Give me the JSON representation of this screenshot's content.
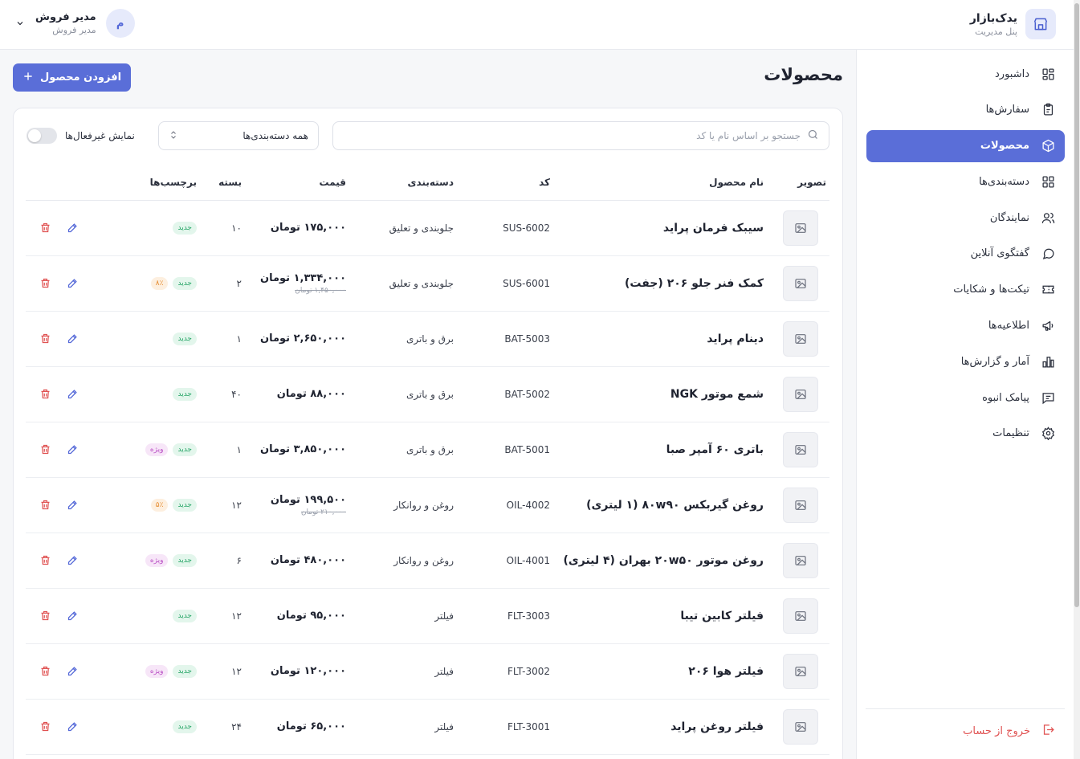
{
  "brand": {
    "name": "یدک‌بازار",
    "subtitle": "پنل مدیریت"
  },
  "user": {
    "name": "مدیر فروش",
    "role": "مدیر فروش",
    "avatar_letter": "م"
  },
  "sidebar": {
    "items": [
      {
        "label": "داشبورد",
        "icon": "dashboard-icon"
      },
      {
        "label": "سفارش‌ها",
        "icon": "clipboard-icon"
      },
      {
        "label": "محصولات",
        "icon": "box-icon",
        "active": true
      },
      {
        "label": "دسته‌بندی‌ها",
        "icon": "grid-icon"
      },
      {
        "label": "نمایندگان",
        "icon": "users-icon"
      },
      {
        "label": "گفتگوی آنلاین",
        "icon": "chat-icon"
      },
      {
        "label": "تیکت‌ها و شکایات",
        "icon": "ticket-icon"
      },
      {
        "label": "اطلاعیه‌ها",
        "icon": "megaphone-icon"
      },
      {
        "label": "آمار و گزارش‌ها",
        "icon": "chart-icon"
      },
      {
        "label": "پیامک انبوه",
        "icon": "message-icon"
      },
      {
        "label": "تنظیمات",
        "icon": "gear-icon"
      }
    ],
    "logout_label": "خروج از حساب"
  },
  "main": {
    "title": "محصولات",
    "add_button": "افزودن محصول",
    "search_placeholder": "جستجو بر اساس نام یا کد",
    "category_select": "همه دسته‌بندی‌ها",
    "show_inactive_label": "نمایش غیرفعال‌ها",
    "show_inactive": false
  },
  "table": {
    "headers": {
      "image": "تصویر",
      "name": "نام محصول",
      "code": "کد",
      "category": "دسته‌بندی",
      "price": "قیمت",
      "pack": "بسته",
      "tags": "برچسب‌ها"
    },
    "rows": [
      {
        "name": "سیبک فرمان پراید",
        "code": "SUS-6002",
        "category": "جلوبندی و تعلیق",
        "price": "۱۷۵,۰۰۰ تومان",
        "old_price": "",
        "pack": "۱۰",
        "tags": [
          "جدید"
        ]
      },
      {
        "name": "کمک فنر جلو ۲۰۶ (جفت)",
        "code": "SUS-6001",
        "category": "جلوبندی و تعلیق",
        "price": "۱,۳۳۴,۰۰۰ تومان",
        "old_price": "۱,۴۵۰,۰۰۰ تومان",
        "pack": "۲",
        "tags": [
          "جدید",
          "۸٪"
        ]
      },
      {
        "name": "دینام پراید",
        "code": "BAT-5003",
        "category": "برق و باتری",
        "price": "۲,۶۵۰,۰۰۰ تومان",
        "old_price": "",
        "pack": "۱",
        "tags": [
          "جدید"
        ]
      },
      {
        "name": "شمع موتور NGK",
        "code": "BAT-5002",
        "category": "برق و باتری",
        "price": "۸۸,۰۰۰ تومان",
        "old_price": "",
        "pack": "۴۰",
        "tags": [
          "جدید"
        ]
      },
      {
        "name": "باتری ۶۰ آمپر صبا",
        "code": "BAT-5001",
        "category": "برق و باتری",
        "price": "۳,۸۵۰,۰۰۰ تومان",
        "old_price": "",
        "pack": "۱",
        "tags": [
          "جدید",
          "ویژه"
        ]
      },
      {
        "name": "روغن گیربکس ۸۰w۹۰ (۱ لیتری)",
        "code": "OIL-4002",
        "category": "روغن و روانکار",
        "price": "۱۹۹,۵۰۰ تومان",
        "old_price": "۲۱۰,۰۰۰ تومان",
        "pack": "۱۲",
        "tags": [
          "جدید",
          "۵٪"
        ]
      },
      {
        "name": "روغن موتور ۲۰w۵۰ بهران (۴ لیتری)",
        "code": "OIL-4001",
        "category": "روغن و روانکار",
        "price": "۴۸۰,۰۰۰ تومان",
        "old_price": "",
        "pack": "۶",
        "tags": [
          "جدید",
          "ویژه"
        ]
      },
      {
        "name": "فیلتر کابین تیبا",
        "code": "FLT-3003",
        "category": "فیلتر",
        "price": "۹۵,۰۰۰ تومان",
        "old_price": "",
        "pack": "۱۲",
        "tags": [
          "جدید"
        ]
      },
      {
        "name": "فیلتر هوا ۲۰۶",
        "code": "FLT-3002",
        "category": "فیلتر",
        "price": "۱۲۰,۰۰۰ تومان",
        "old_price": "",
        "pack": "۱۲",
        "tags": [
          "جدید",
          "ویژه"
        ]
      },
      {
        "name": "فیلتر روغن پراید",
        "code": "FLT-3001",
        "category": "فیلتر",
        "price": "۶۵,۰۰۰ تومان",
        "old_price": "",
        "pack": "۲۴",
        "tags": [
          "جدید"
        ]
      }
    ]
  },
  "colors": {
    "accent": "#5a6ed8",
    "danger": "#e05252",
    "tag_new": "#27a567",
    "tag_special": "#b94ec4",
    "tag_discount": "#e58a2c"
  }
}
